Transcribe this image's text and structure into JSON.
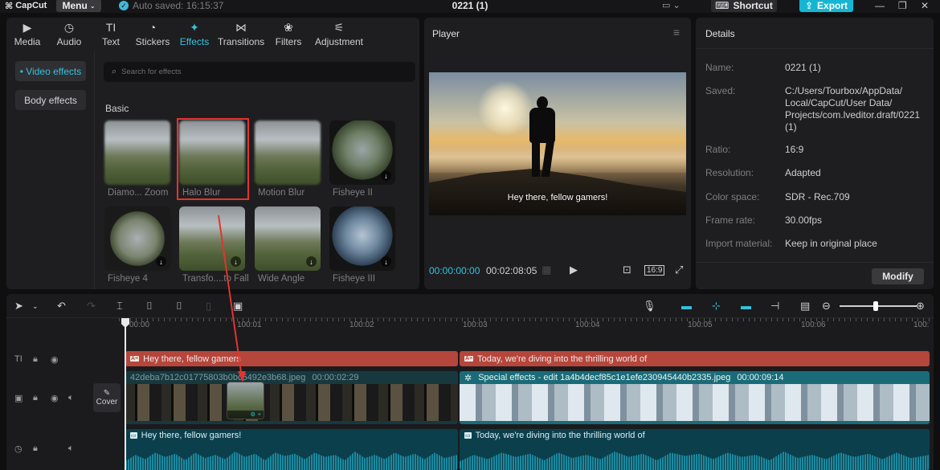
{
  "app": {
    "logo": "CapCut",
    "menu_label": "Menu",
    "autosave_text": "Auto saved: 16:15:37",
    "project_title": "0221 (1)",
    "shortcut_label": "Shortcut",
    "export_label": "Export"
  },
  "media_tabs": [
    {
      "label": "Media",
      "icon": "media-icon"
    },
    {
      "label": "Audio",
      "icon": "audio-icon"
    },
    {
      "label": "Text",
      "icon": "text-icon"
    },
    {
      "label": "Stickers",
      "icon": "stickers-icon"
    },
    {
      "label": "Effects",
      "icon": "effects-icon",
      "active": true
    },
    {
      "label": "Transitions",
      "icon": "transitions-icon"
    },
    {
      "label": "Filters",
      "icon": "filters-icon"
    },
    {
      "label": "Adjustment",
      "icon": "adjustment-icon"
    }
  ],
  "effects_sidebar": {
    "video_effects": "• Video effects",
    "body_effects": "Body effects"
  },
  "search": {
    "placeholder": "Search for effects"
  },
  "section_title": "Basic",
  "effects": [
    {
      "label": "Diamo... Zoom",
      "style": "scene-blur",
      "download": false
    },
    {
      "label": "Halo Blur",
      "style": "scene-blur",
      "download": false,
      "selected": true
    },
    {
      "label": "Motion Blur",
      "style": "scene-blur",
      "download": false
    },
    {
      "label": "Fisheye II",
      "style": "fisheye",
      "download": true
    },
    {
      "label": "Fisheye 4",
      "style": "fisheye4",
      "download": true
    },
    {
      "label": "Transfo....to Fall",
      "style": "scene",
      "download": true
    },
    {
      "label": "Wide Angle",
      "style": "scene",
      "download": true
    },
    {
      "label": "Fisheye III",
      "style": "fisheye-blue",
      "download": true
    }
  ],
  "player": {
    "title": "Player",
    "caption": "Hey there, fellow gamers!",
    "current_time": "00:00:00:00",
    "duration": "00:02:08:05",
    "ratio_label": "16:9"
  },
  "details": {
    "title": "Details",
    "rows": [
      {
        "label": "Name:",
        "value": "0221 (1)"
      },
      {
        "label": "Saved:",
        "value": "C:/Users/Tourbox/AppData/ Local/CapCut/User Data/ Projects/com.lveditor.draft/0221 (1)"
      },
      {
        "label": "Ratio:",
        "value": "16:9"
      },
      {
        "label": "Resolution:",
        "value": "Adapted"
      },
      {
        "label": "Color space:",
        "value": "SDR - Rec.709"
      },
      {
        "label": "Frame rate:",
        "value": "30.00fps"
      },
      {
        "label": "Import material:",
        "value": "Keep in original place"
      }
    ],
    "modify_label": "Modify"
  },
  "timeline": {
    "ruler": [
      "00:00",
      "100:01",
      "100:02",
      "100:03",
      "100:04",
      "100:05",
      "100:06",
      "100:"
    ],
    "cover_label": "Cover",
    "text_clips": [
      {
        "text": "Hey there, fellow gamers"
      },
      {
        "text": "Today, we're diving into the thrilling world of"
      }
    ],
    "video_clips": [
      {
        "name": "42deba7b12c01775803b0bc5492e3b68.jpeg",
        "duration": "00:00:02:29"
      },
      {
        "name": "Special effects - edit  1a4b4decf85c1e1efe230945440b2335.jpeg",
        "duration": "00:00:09:14"
      }
    ],
    "audio_clips": [
      {
        "text": "Hey there, fellow gamers!"
      },
      {
        "text": "Today, we're diving into the thrilling world of"
      }
    ]
  }
}
